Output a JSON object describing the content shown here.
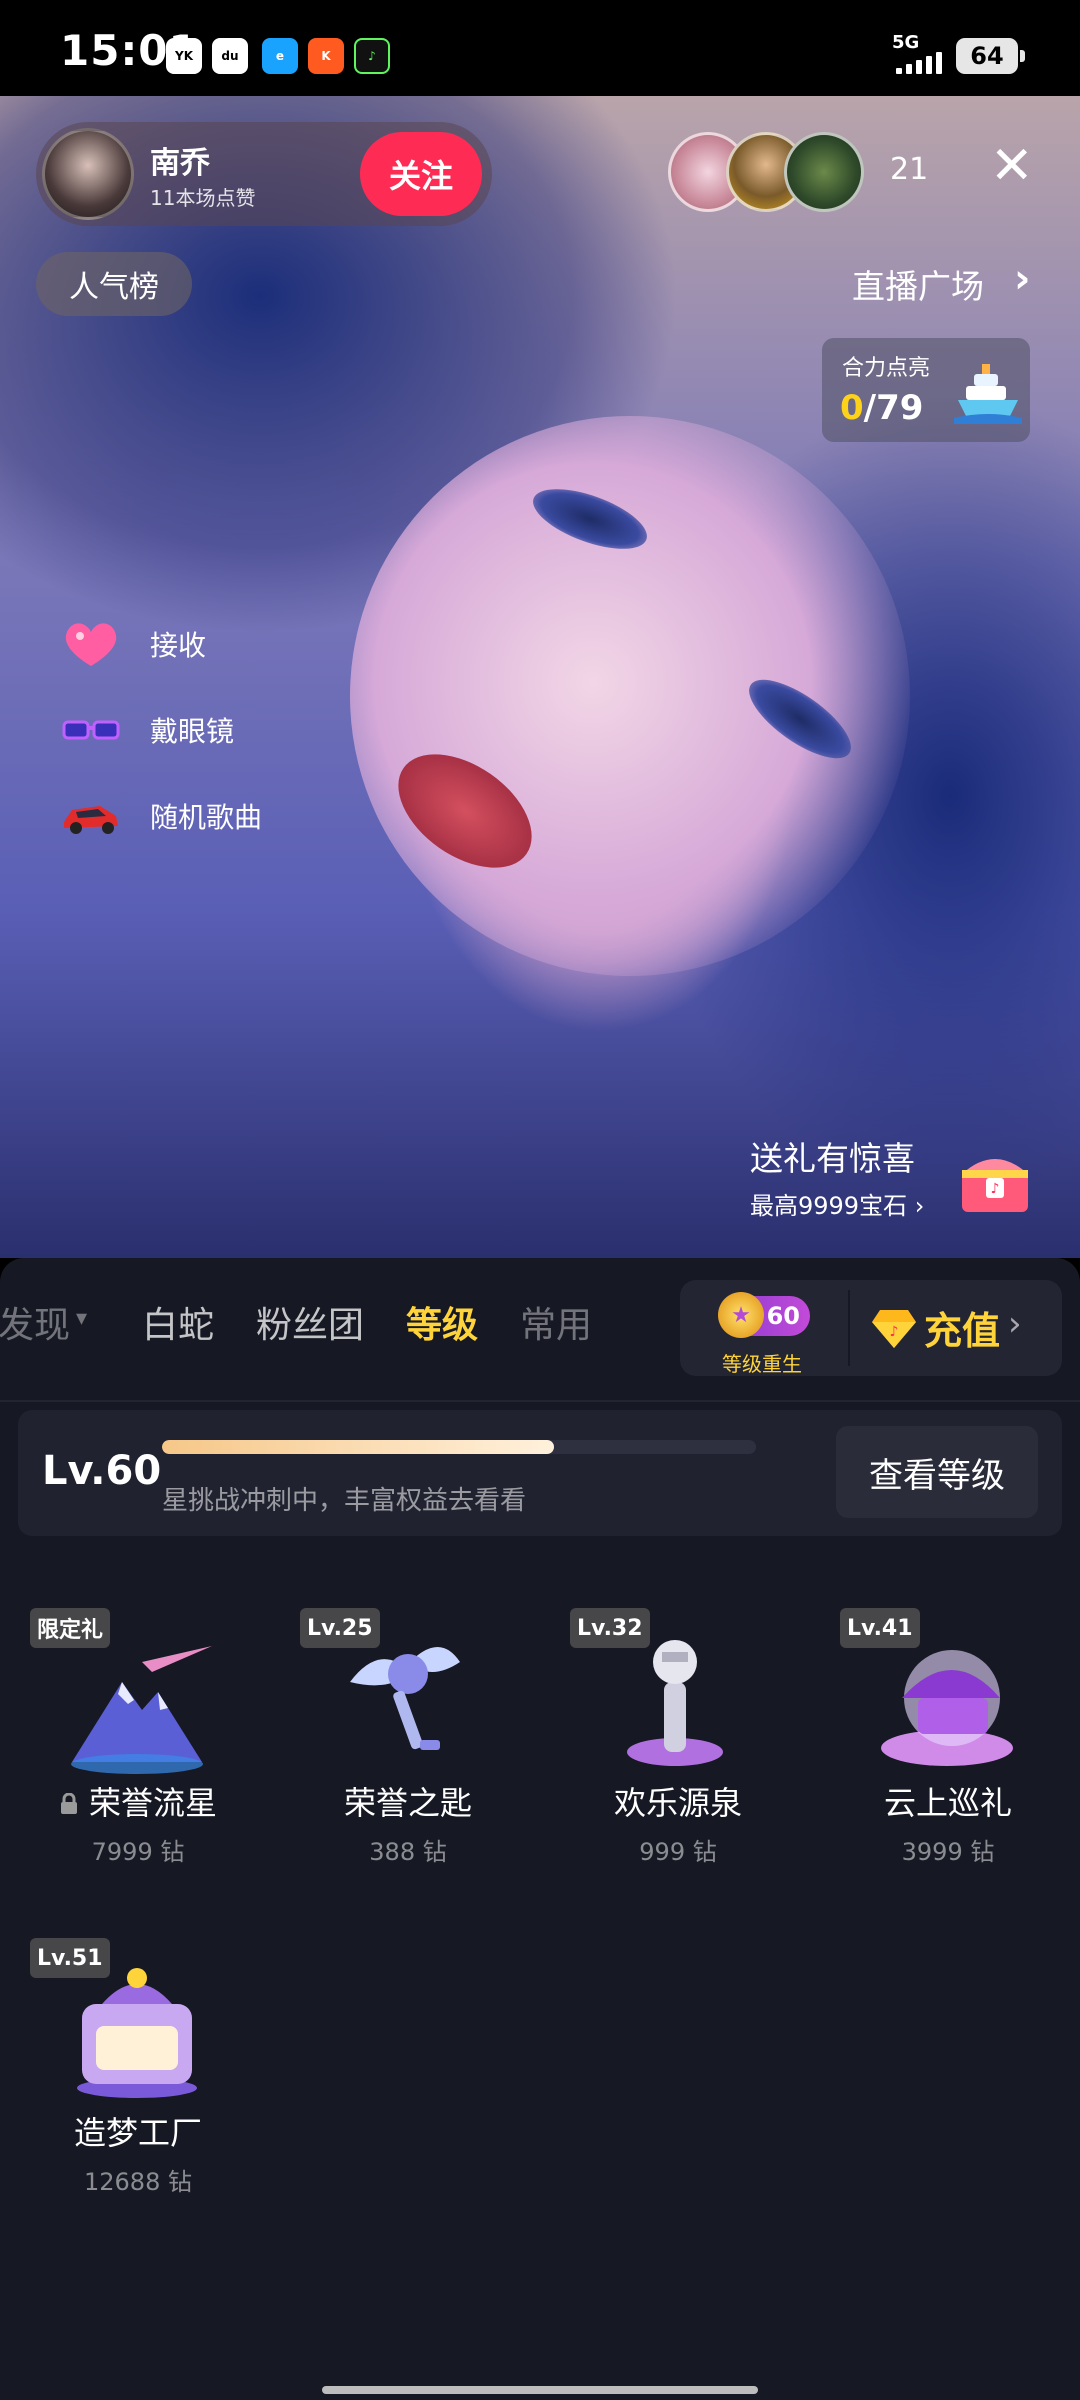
{
  "status_bar": {
    "time": "15:01",
    "network": "5G",
    "battery": "64",
    "apps": [
      "youku-icon",
      "du-icon",
      "map-pin-icon",
      "ele-icon",
      "kuaishou-icon",
      "douyin-icon"
    ]
  },
  "live": {
    "host_name": "南乔",
    "host_likes": "11本场点赞",
    "follow_label": "关注",
    "viewer_count": "21",
    "rank_label": "人气榜",
    "plaza_label": "直播广场",
    "light_up": {
      "title": "合力点亮",
      "current": "0",
      "total": "/79"
    },
    "effects": [
      {
        "label": "接收",
        "icon": "heart-gift-icon"
      },
      {
        "label": "戴眼镜",
        "icon": "glasses-icon"
      },
      {
        "label": "随机歌曲",
        "icon": "sports-car-icon"
      }
    ],
    "gift_surprise": {
      "title": "送礼有惊喜",
      "subtitle": "最高9999宝石 ›"
    }
  },
  "panel": {
    "tabs": [
      {
        "label": "发现",
        "state": "faded"
      },
      {
        "label": "白蛇",
        "state": "normal"
      },
      {
        "label": "粉丝团",
        "state": "normal"
      },
      {
        "label": "等级",
        "state": "active"
      },
      {
        "label": "常用",
        "state": "faded"
      }
    ],
    "rebirth": {
      "badge": "60",
      "label": "等级重生"
    },
    "recharge_label": "充值",
    "level": {
      "value": "Lv.60",
      "progress": 0.66,
      "tip": "星挑战冲刺中，丰富权益去看看",
      "view_button": "查看等级"
    },
    "gifts": [
      {
        "tag": "限定礼",
        "name": "荣誉流星",
        "price": "7999 钻",
        "locked": true
      },
      {
        "tag": "Lv.25",
        "name": "荣誉之匙",
        "price": "388 钻",
        "locked": false
      },
      {
        "tag": "Lv.32",
        "name": "欢乐源泉",
        "price": "999 钻",
        "locked": false
      },
      {
        "tag": "Lv.41",
        "name": "云上巡礼",
        "price": "3999 钻",
        "locked": false
      },
      {
        "tag": "Lv.51",
        "name": "造梦工厂",
        "price": "12688 钻",
        "locked": false
      }
    ]
  },
  "colors": {
    "follow": "#fe2c55",
    "accent_gold": "#ffd43b",
    "panel_bg": "#161823"
  }
}
